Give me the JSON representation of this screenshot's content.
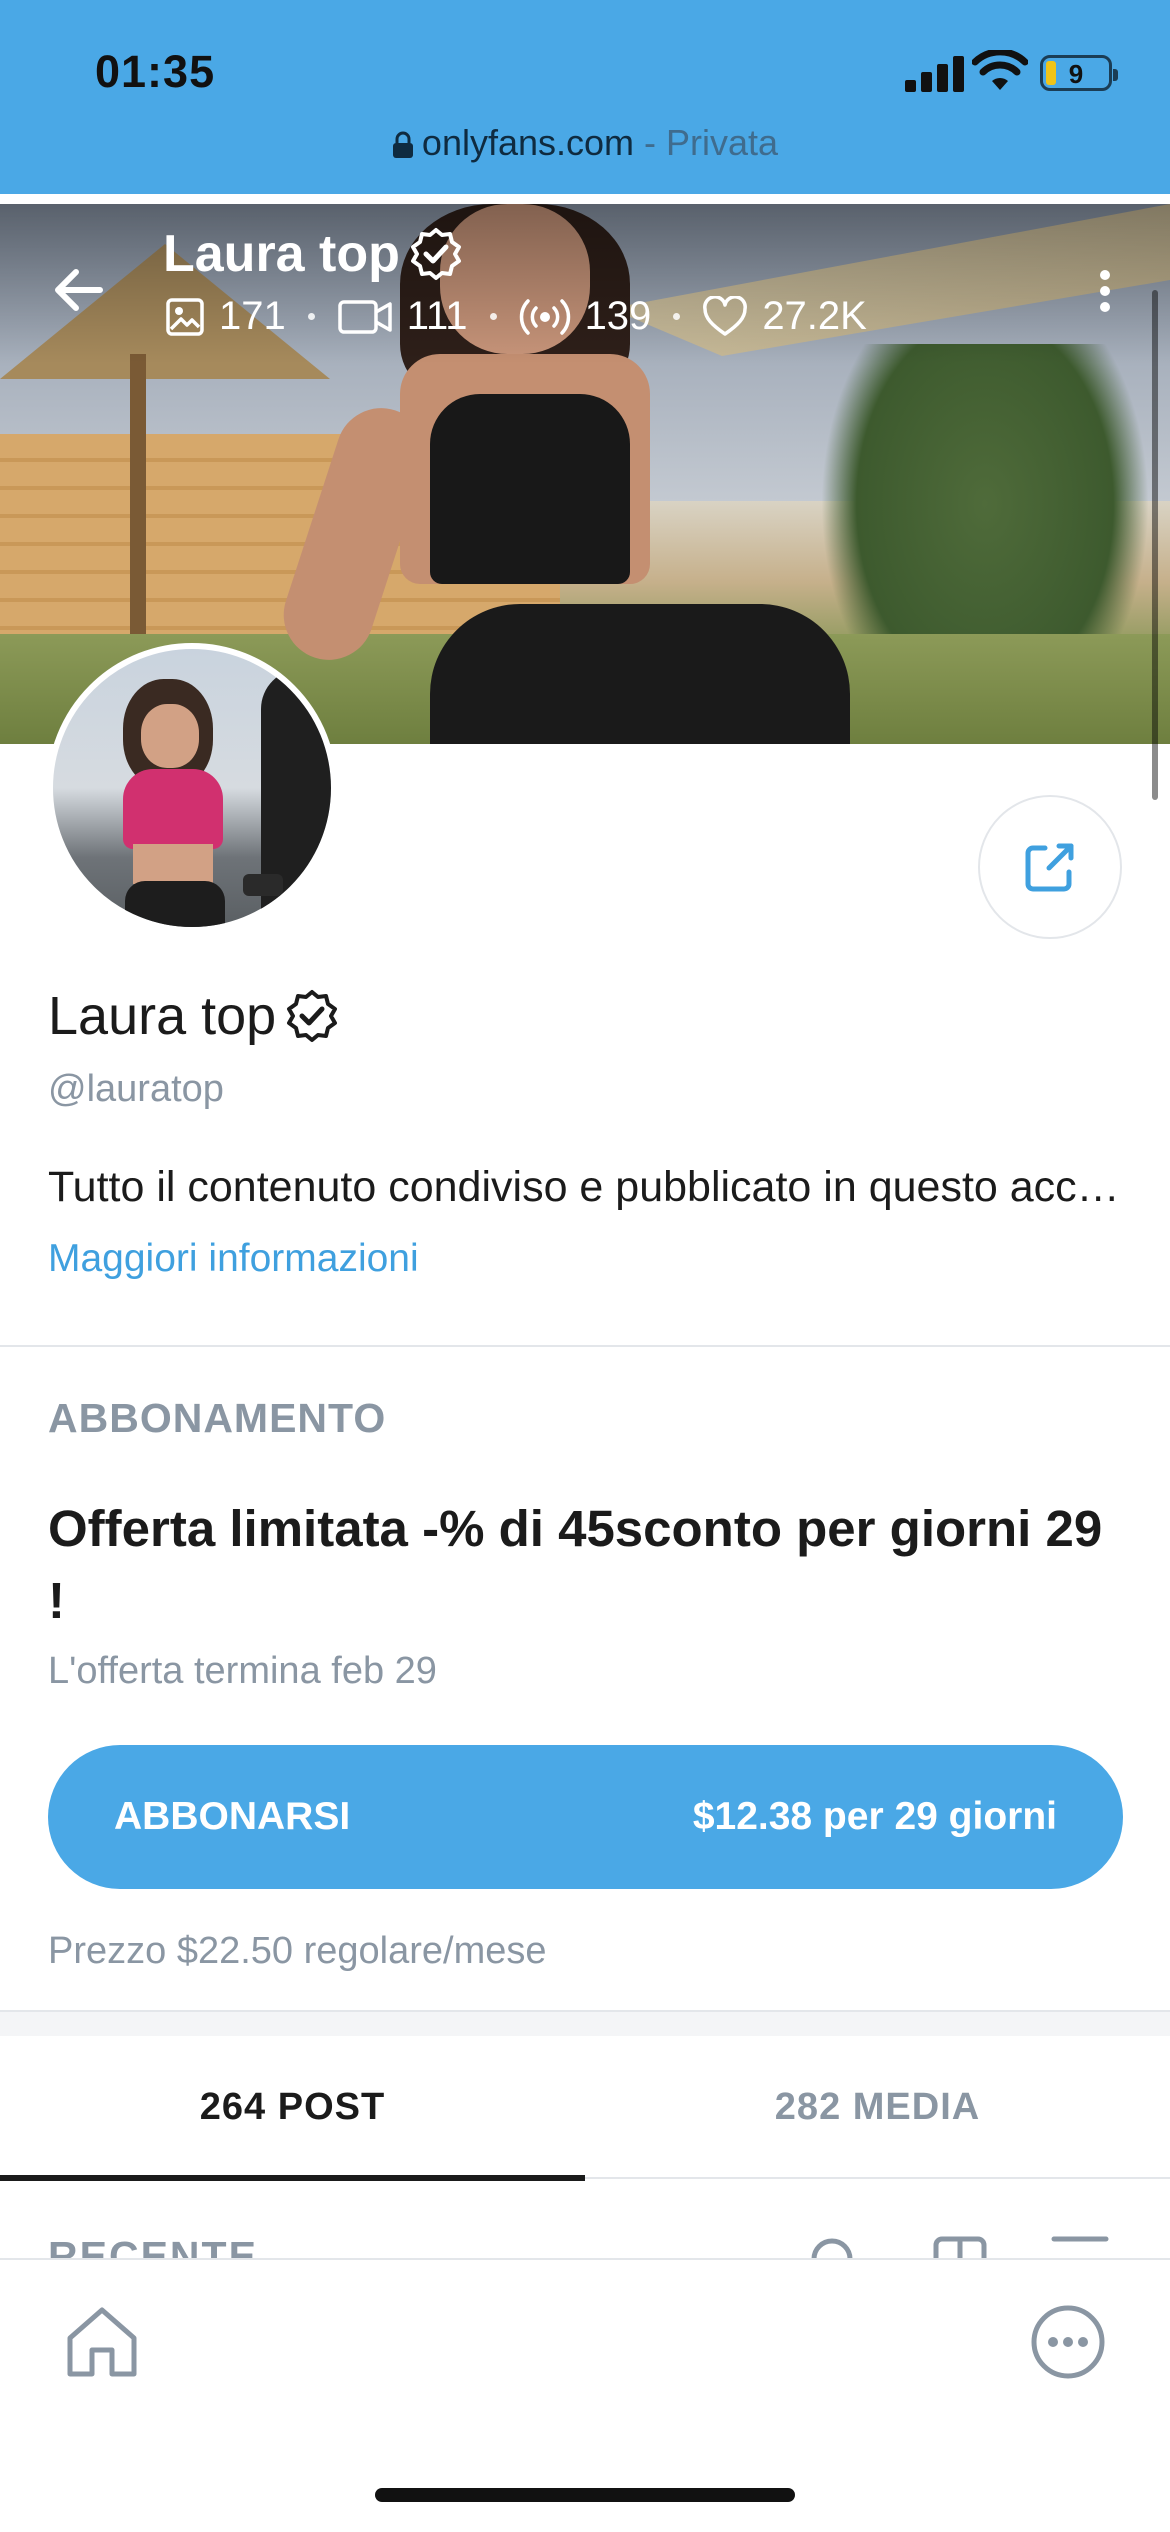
{
  "status_bar": {
    "time": "01:35",
    "battery": "9"
  },
  "browser": {
    "domain": "onlyfans.com",
    "separator": " - ",
    "mode": "Privata"
  },
  "cover": {
    "name": "Laura top",
    "stats": {
      "photos": "171",
      "videos": "111",
      "streams": "139",
      "likes": "27.2K"
    }
  },
  "profile": {
    "name": "Laura top",
    "handle": "@lauratop",
    "bio": "Tutto il contenuto condiviso e pubblicato in questo account è di mia proprietà",
    "more_info": "Maggiori informazioni"
  },
  "subscription": {
    "label": "ABBONAMENTO",
    "offer_title": "Offerta limitata -% di 45sconto per giorni 29 !",
    "offer_ends": "L'offerta termina feb 29",
    "button_label": "ABBONARSI",
    "button_price": "$12.38 per 29 giorni",
    "regular_price": "Prezzo $22.50 regolare/mese"
  },
  "tabs": [
    {
      "label": "264 POST",
      "active": true
    },
    {
      "label": "282 MEDIA",
      "active": false
    }
  ],
  "feed": {
    "section_label": "RECENTE"
  },
  "icons": {
    "verified": "verified-badge-icon",
    "share": "share-icon",
    "home": "home-icon",
    "more": "more-options-icon"
  },
  "colors": {
    "accent": "#4aa8e6",
    "link": "#3fa0df",
    "muted": "#8a96a3",
    "text": "#1b1b1b"
  }
}
